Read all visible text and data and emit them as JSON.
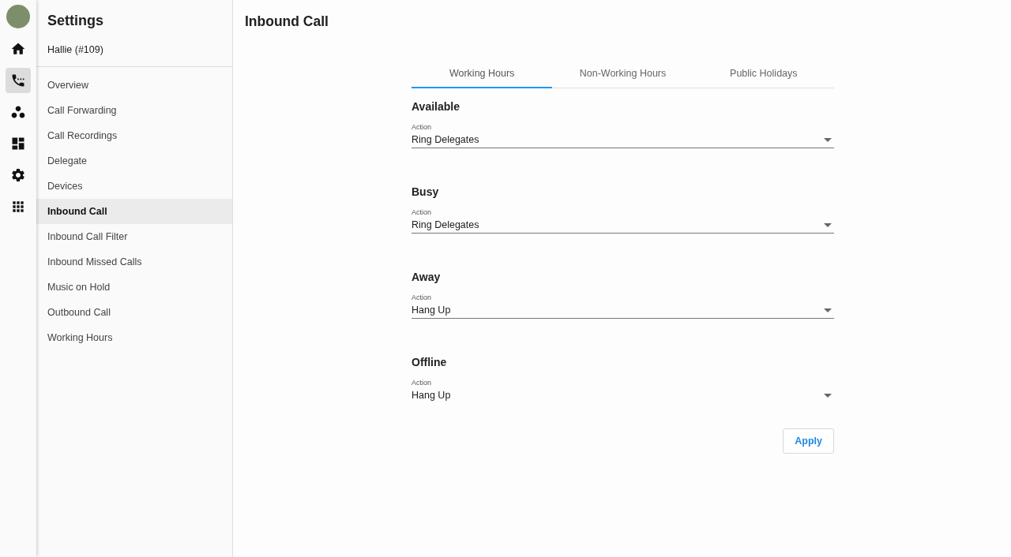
{
  "rail": {
    "items": [
      {
        "kind": "home",
        "selected": false
      },
      {
        "kind": "phone",
        "selected": true
      },
      {
        "kind": "group",
        "selected": false
      },
      {
        "kind": "dashboard",
        "selected": false
      },
      {
        "kind": "settings",
        "selected": false
      },
      {
        "kind": "apps",
        "selected": false
      }
    ]
  },
  "sidebar": {
    "title": "Settings",
    "user": "Hallie (#109)",
    "items": [
      {
        "label": "Overview",
        "selected": false
      },
      {
        "label": "Call Forwarding",
        "selected": false
      },
      {
        "label": "Call Recordings",
        "selected": false
      },
      {
        "label": "Delegate",
        "selected": false
      },
      {
        "label": "Devices",
        "selected": false
      },
      {
        "label": "Inbound Call",
        "selected": true
      },
      {
        "label": "Inbound Call Filter",
        "selected": false
      },
      {
        "label": "Inbound Missed Calls",
        "selected": false
      },
      {
        "label": "Music on Hold",
        "selected": false
      },
      {
        "label": "Outbound Call",
        "selected": false
      },
      {
        "label": "Working Hours",
        "selected": false
      }
    ]
  },
  "page": {
    "title": "Inbound Call"
  },
  "tabs": [
    {
      "label": "Working Hours",
      "selected": true
    },
    {
      "label": "Non-Working Hours",
      "selected": false
    },
    {
      "label": "Public Holidays",
      "selected": false
    }
  ],
  "sections": [
    {
      "title": "Available",
      "field_label": "Action",
      "value": "Ring Delegates",
      "underlined": true
    },
    {
      "title": "Busy",
      "field_label": "Action",
      "value": "Ring Delegates",
      "underlined": true
    },
    {
      "title": "Away",
      "field_label": "Action",
      "value": "Hang Up",
      "underlined": true
    },
    {
      "title": "Offline",
      "field_label": "Action",
      "value": "Hang Up",
      "underlined": false
    }
  ],
  "apply_button": "Apply"
}
